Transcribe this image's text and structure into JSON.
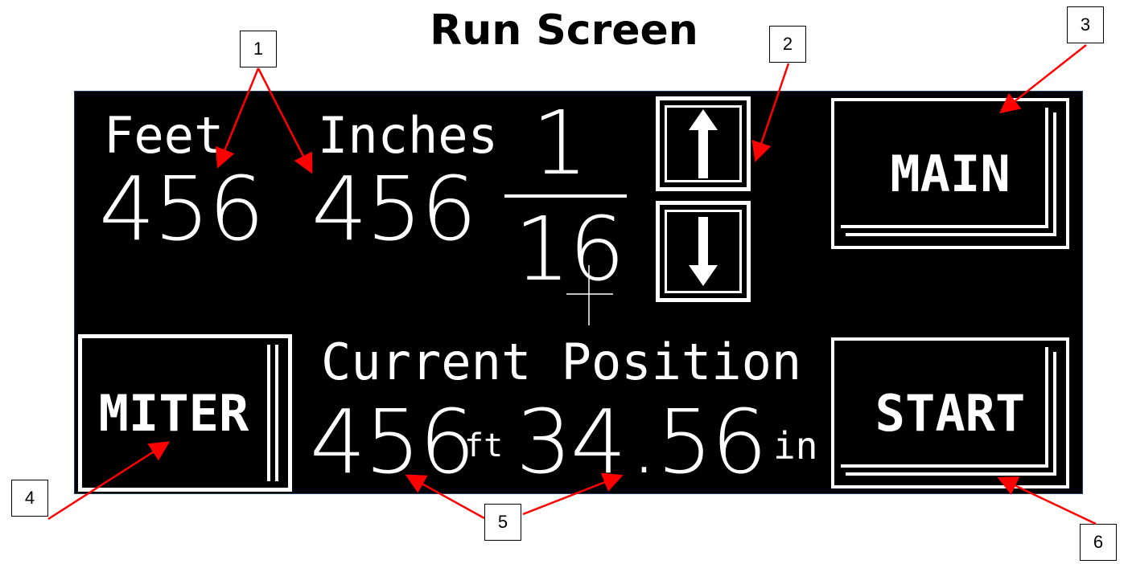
{
  "title": "Run Screen",
  "callouts": [
    "1",
    "2",
    "3",
    "4",
    "5",
    "6"
  ],
  "screen": {
    "feet_label": "Feet",
    "inches_label": "Inches",
    "feet_value": "456",
    "inches_value": "456",
    "fraction_numerator": "1",
    "fraction_denominator": "16",
    "up_icon": "arrow-up-icon",
    "down_icon": "arrow-down-icon",
    "main_label": "MAIN",
    "miter_label": "MITER",
    "start_label": "START",
    "current_position_label": "Current Position",
    "position_feet": "456",
    "position_feet_unit": "ft",
    "position_inches": "34",
    "position_decimal": ".56",
    "position_inches_unit": "in"
  },
  "colors": {
    "screen_bg": "#000000",
    "screen_fg": "#ffffff",
    "callout_arrow": "#ff0000",
    "panel_border": "#1f3d66"
  }
}
